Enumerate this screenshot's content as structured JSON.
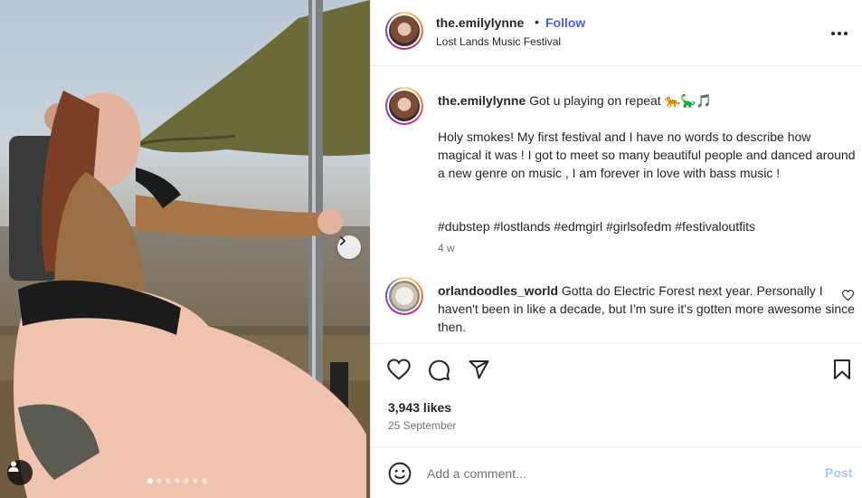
{
  "post": {
    "author": "the.emilylynne",
    "separator": "•",
    "follow_label": "Follow",
    "location": "Lost Lands Music Festival",
    "caption_heading": "Got u playing on repeat 🐆🦕🎵",
    "caption_body": "Holy smokes! My first festival and I have no words to describe how magical it was ! I got to meet so many beautiful people and danced around a new genre on music , I am forever in love with bass music !",
    "hashtags": "#dubstep #lostlands #edmgirl #girlsofedm #festivaloutfits",
    "age": "4 w"
  },
  "comment": {
    "author": "orlandoodles_world",
    "text": "Gotta do Electric Forest next year. Personally I haven't been in like a decade, but I'm sure it's gotten more awesome since then."
  },
  "likes": "3,943 likes",
  "date": "25 September",
  "add_comment": {
    "placeholder": "Add a comment...",
    "post_label": "Post"
  },
  "media": {
    "carousel_total": 7,
    "carousel_active": 1
  },
  "colors": {
    "link_blue": "#4a5df9",
    "hashtag_blue": "#3f51b5",
    "post_disabled": "#b2c4f7"
  }
}
